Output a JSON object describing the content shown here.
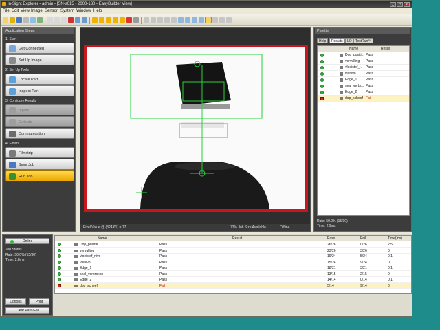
{
  "window": {
    "title": "In-Sight Explorer - admin - [SN-s015 - 2000-130 - EasyBuilder View]"
  },
  "menu": [
    "File",
    "Edit",
    "View",
    "Image",
    "Sensor",
    "System",
    "Window",
    "Help"
  ],
  "app_steps": {
    "header": "Application Steps",
    "sections": [
      {
        "label": "1. Start",
        "buttons": [
          {
            "label": "Get Connected",
            "state": "normal"
          },
          {
            "label": "Set Up Image",
            "state": "normal"
          }
        ]
      },
      {
        "label": "2. Set Up Tools",
        "buttons": [
          {
            "label": "Locate Part",
            "state": "normal"
          },
          {
            "label": "Inspect Part",
            "state": "normal"
          }
        ]
      },
      {
        "label": "3. Configure Results",
        "buttons": [
          {
            "label": "Inputs",
            "state": "disabled"
          },
          {
            "label": "Outputs",
            "state": "disabled"
          },
          {
            "label": "Communication",
            "state": "normal"
          }
        ]
      },
      {
        "label": "4. Finish",
        "buttons": [
          {
            "label": "Filmstrip",
            "state": "normal"
          },
          {
            "label": "Save Job",
            "state": "normal"
          },
          {
            "label": "Run Job",
            "state": "active"
          }
        ]
      }
    ]
  },
  "viewer_status": {
    "pixel": "Pixel Value @ (324,61) = 17",
    "job_size": "73% Job Size Available",
    "mode": "Offline"
  },
  "palette": {
    "header": "Palette",
    "tabs": [
      "Help",
      "Results",
      "I/O",
      "TestRun™"
    ],
    "active_tab": "Results",
    "columns": [
      "Name",
      "Result"
    ],
    "rows": [
      {
        "name": "Dop_positi...",
        "result": "Pass",
        "status": "pass"
      },
      {
        "name": "vervulling",
        "result": "Pass",
        "status": "pass"
      },
      {
        "name": "vloeistof_...",
        "result": "Pass",
        "status": "pass"
      },
      {
        "name": "vulnivo",
        "result": "Pass",
        "status": "pass"
      },
      {
        "name": "Edge_1",
        "result": "Pass",
        "status": "pass"
      },
      {
        "name": "seal_verbr...",
        "result": "Pass",
        "status": "pass"
      },
      {
        "name": "Edge_2",
        "result": "Pass",
        "status": "pass"
      },
      {
        "name": "dop_scheef",
        "result": "Fail",
        "status": "fail"
      }
    ],
    "rate": "Rate: 50.0% (15/30)",
    "time": "Time: 2.9ms"
  },
  "job_panel": {
    "online_label": "Online",
    "job_status_label": "Job Status",
    "rate": "Rate: 50.0% (15/30)",
    "time": "Time: 2.8ms",
    "options_label": "Options",
    "print_label": "Print",
    "clear_label": "Clear Pass/Fail"
  },
  "results_table": {
    "columns": [
      "Name",
      "Result",
      "Pass",
      "Fail",
      "Time(ms)"
    ],
    "rows": [
      {
        "name": "Dop_positie",
        "result": "Pass",
        "pass": "26/26",
        "fail": "0/26",
        "time": "2.5",
        "status": "pass"
      },
      {
        "name": "vervulling",
        "result": "Pass",
        "pass": "23/26",
        "fail": "3/26",
        "time": "0",
        "status": "pass"
      },
      {
        "name": "vloeistof_nivo",
        "result": "Pass",
        "pass": "19/24",
        "fail": "5/24",
        "time": "0.1",
        "status": "pass"
      },
      {
        "name": "vulnivo",
        "result": "Pass",
        "pass": "15/24",
        "fail": "9/24",
        "time": "0",
        "status": "pass"
      },
      {
        "name": "Edge_1",
        "result": "Pass",
        "pass": "18/21",
        "fail": "3/21",
        "time": "0.1",
        "status": "pass"
      },
      {
        "name": "seal_verbroken",
        "result": "Pass",
        "pass": "13/15",
        "fail": "2/15",
        "time": "0",
        "status": "pass"
      },
      {
        "name": "Edge_2",
        "result": "Pass",
        "pass": "14/14",
        "fail": "0/14",
        "time": "0.1",
        "status": "pass"
      },
      {
        "name": "dop_scheef",
        "result": "Fail",
        "pass": "5/14",
        "fail": "9/14",
        "time": "0",
        "status": "fail"
      }
    ]
  }
}
